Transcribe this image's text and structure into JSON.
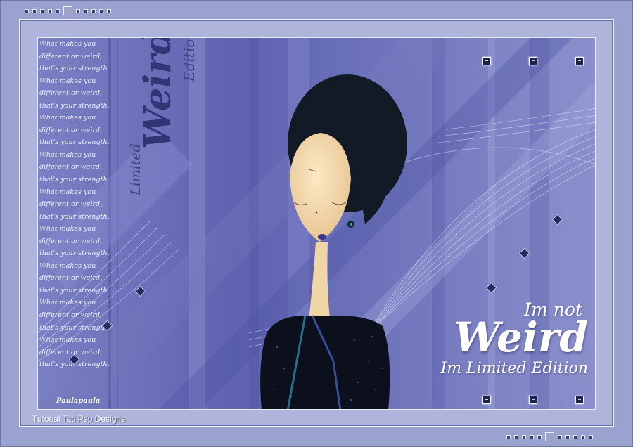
{
  "poem": {
    "lines": [
      "What makes you",
      "different or weird,",
      "that's your strength.",
      "What makes you",
      "different or weird,",
      "that's your strength.",
      "What makes you",
      "different or weird,",
      "that's your strength.",
      "What makes you",
      "different or weird,",
      "that's your strength.",
      "What makes you",
      "different or weird,",
      "that's your strength.",
      "What makes you",
      "different or weird,",
      "that's your strength.",
      "What makes you",
      "different or weird,",
      "that's your strength.",
      "What makes you",
      "different or weird,",
      "that's your strength.",
      "What makes you",
      "different or weird,",
      "that's your strength."
    ]
  },
  "vertical_text": {
    "limited": "Limited",
    "weird": "Weird",
    "edition": "Edition"
  },
  "title": {
    "line1": "Im not",
    "line2": "Weird",
    "line3": "Im Limited Edition"
  },
  "signature": "Paulapaula",
  "credit": "Tutorial Tati Psp Designs",
  "colors": {
    "frame": "#9aa2d0",
    "art_base": "#6b70b8",
    "dark_accent": "#1d2250",
    "text_white": "#ffffff",
    "hair": "#121a26",
    "skin": "#f6dfb4"
  },
  "icons": {
    "square_marker": "square-marker-icon",
    "diamond_marker": "diamond-marker-icon"
  }
}
